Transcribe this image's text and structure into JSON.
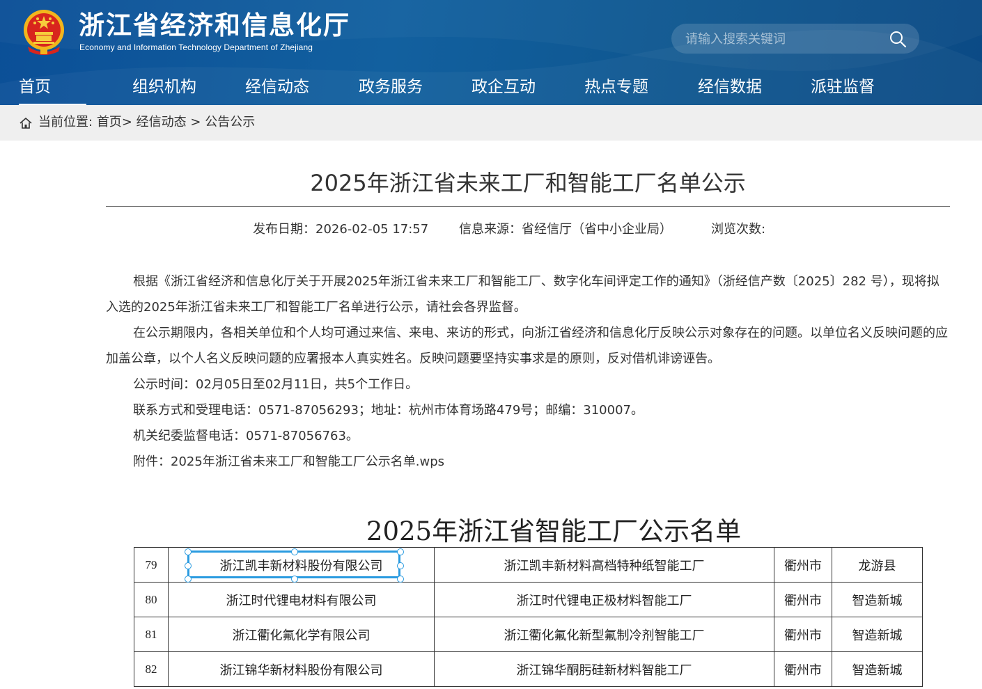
{
  "header": {
    "title": "浙江省经济和信息化厅",
    "subtitle": "Economy and Information Technology Department of Zhejiang",
    "search_placeholder": "请输入搜索关键词",
    "nav": [
      "首页",
      "组织机构",
      "经信动态",
      "政务服务",
      "政企互动",
      "热点专题",
      "经信数据",
      "派驻监督"
    ],
    "active_nav": "首页"
  },
  "breadcrumb": {
    "prefix": "当前位置:",
    "home": "首页",
    "sep1": ">",
    "section": "经信动态",
    "sep2": ">",
    "current": "公告公示"
  },
  "article": {
    "title": "2025年浙江省未来工厂和智能工厂名单公示",
    "publish_date": "发布日期：2026-02-05 17:57",
    "source": "信息来源：省经信厅（省中小企业局）",
    "views": "浏览次数:",
    "paragraphs": [
      "根据《浙江省经济和信息化厅关于开展2025年浙江省未来工厂和智能工厂、数字化车间评定工作的通知》（浙经信产数〔2025〕282 号），现将拟入选的2025年浙江省未来工厂和智能工厂名单进行公示，请社会各界监督。",
      "在公示期限内，各相关单位和个人均可通过来信、来电、来访的形式，向浙江省经济和信息化厅反映公示对象存在的问题。以单位名义反映问题的应加盖公章，以个人名义反映问题的应署报本人真实姓名。反映问题要坚持实事求是的原则，反对借机诽谤诬告。",
      "公示时间：02月05日至02月11日，共5个工作日。",
      "联系方式和受理电话：0571-87056293；地址：杭州市体育场路479号；邮编：310007。",
      "机关纪委监督电话：0571-87056763。"
    ],
    "attachment_label": "附件：",
    "attachment_link": "2025年浙江省未来工厂和智能工厂公示名单.wps"
  },
  "table": {
    "title": "2025年浙江省智能工厂公示名单",
    "rows": [
      {
        "no": "79",
        "company": "浙江凯丰新材料股份有限公司",
        "project": "浙江凯丰新材料高档特种纸智能工厂",
        "city": "衢州市",
        "county": "龙游县"
      },
      {
        "no": "80",
        "company": "浙江时代锂电材料有限公司",
        "project": "浙江时代锂电正极材料智能工厂",
        "city": "衢州市",
        "county": "智造新城"
      },
      {
        "no": "81",
        "company": "浙江衢化氟化学有限公司",
        "project": "浙江衢化氟化新型氟制冷剂智能工厂",
        "city": "衢州市",
        "county": "智造新城"
      },
      {
        "no": "82",
        "company": "浙江锦华新材料股份有限公司",
        "project": "浙江锦华酮肟硅新材料智能工厂",
        "city": "衢州市",
        "county": "智造新城"
      }
    ]
  },
  "colors": {
    "header_blue": "#0f5a9c",
    "selection_blue": "#2a9be0",
    "crumb_bg": "#efefef"
  }
}
